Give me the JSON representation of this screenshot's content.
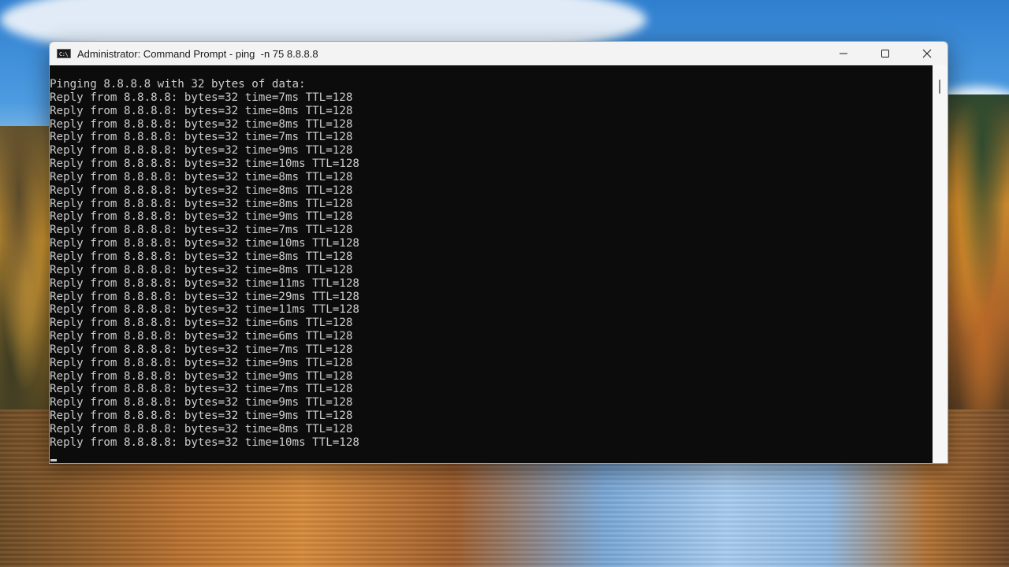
{
  "window": {
    "title": "Administrator: Command Prompt - ping  -n 75 8.8.8.8",
    "icon": "command-prompt-icon",
    "icon_label": "C:\\",
    "controls": [
      "minimize-icon",
      "maximize-icon",
      "close-icon"
    ]
  },
  "console": {
    "lines": [
      "Pinging 8.8.8.8 with 32 bytes of data:",
      "Reply from 8.8.8.8: bytes=32 time=7ms TTL=128",
      "Reply from 8.8.8.8: bytes=32 time=8ms TTL=128",
      "Reply from 8.8.8.8: bytes=32 time=8ms TTL=128",
      "Reply from 8.8.8.8: bytes=32 time=7ms TTL=128",
      "Reply from 8.8.8.8: bytes=32 time=9ms TTL=128",
      "Reply from 8.8.8.8: bytes=32 time=10ms TTL=128",
      "Reply from 8.8.8.8: bytes=32 time=8ms TTL=128",
      "Reply from 8.8.8.8: bytes=32 time=8ms TTL=128",
      "Reply from 8.8.8.8: bytes=32 time=8ms TTL=128",
      "Reply from 8.8.8.8: bytes=32 time=9ms TTL=128",
      "Reply from 8.8.8.8: bytes=32 time=7ms TTL=128",
      "Reply from 8.8.8.8: bytes=32 time=10ms TTL=128",
      "Reply from 8.8.8.8: bytes=32 time=8ms TTL=128",
      "Reply from 8.8.8.8: bytes=32 time=8ms TTL=128",
      "Reply from 8.8.8.8: bytes=32 time=11ms TTL=128",
      "Reply from 8.8.8.8: bytes=32 time=29ms TTL=128",
      "Reply from 8.8.8.8: bytes=32 time=11ms TTL=128",
      "Reply from 8.8.8.8: bytes=32 time=6ms TTL=128",
      "Reply from 8.8.8.8: bytes=32 time=6ms TTL=128",
      "Reply from 8.8.8.8: bytes=32 time=7ms TTL=128",
      "Reply from 8.8.8.8: bytes=32 time=9ms TTL=128",
      "Reply from 8.8.8.8: bytes=32 time=9ms TTL=128",
      "Reply from 8.8.8.8: bytes=32 time=7ms TTL=128",
      "Reply from 8.8.8.8: bytes=32 time=9ms TTL=128",
      "Reply from 8.8.8.8: bytes=32 time=9ms TTL=128",
      "Reply from 8.8.8.8: bytes=32 time=8ms TTL=128",
      "Reply from 8.8.8.8: bytes=32 time=10ms TTL=128"
    ]
  },
  "colors": {
    "console_background": "#0c0c0c",
    "console_text": "#cccccc",
    "titlebar_background": "#f3f3f3"
  }
}
